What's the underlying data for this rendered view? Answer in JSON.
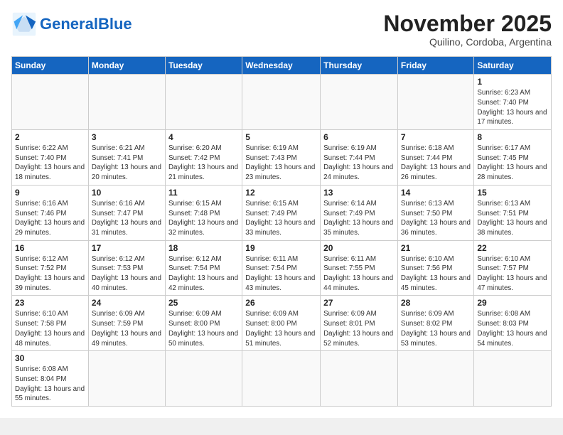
{
  "header": {
    "logo_general": "General",
    "logo_blue": "Blue",
    "month_title": "November 2025",
    "subtitle": "Quilino, Cordoba, Argentina"
  },
  "days_of_week": [
    "Sunday",
    "Monday",
    "Tuesday",
    "Wednesday",
    "Thursday",
    "Friday",
    "Saturday"
  ],
  "weeks": [
    [
      {
        "day": "",
        "info": ""
      },
      {
        "day": "",
        "info": ""
      },
      {
        "day": "",
        "info": ""
      },
      {
        "day": "",
        "info": ""
      },
      {
        "day": "",
        "info": ""
      },
      {
        "day": "",
        "info": ""
      },
      {
        "day": "1",
        "info": "Sunrise: 6:23 AM\nSunset: 7:40 PM\nDaylight: 13 hours\nand 17 minutes."
      }
    ],
    [
      {
        "day": "2",
        "info": "Sunrise: 6:22 AM\nSunset: 7:40 PM\nDaylight: 13 hours\nand 18 minutes."
      },
      {
        "day": "3",
        "info": "Sunrise: 6:21 AM\nSunset: 7:41 PM\nDaylight: 13 hours\nand 20 minutes."
      },
      {
        "day": "4",
        "info": "Sunrise: 6:20 AM\nSunset: 7:42 PM\nDaylight: 13 hours\nand 21 minutes."
      },
      {
        "day": "5",
        "info": "Sunrise: 6:19 AM\nSunset: 7:43 PM\nDaylight: 13 hours\nand 23 minutes."
      },
      {
        "day": "6",
        "info": "Sunrise: 6:19 AM\nSunset: 7:44 PM\nDaylight: 13 hours\nand 24 minutes."
      },
      {
        "day": "7",
        "info": "Sunrise: 6:18 AM\nSunset: 7:44 PM\nDaylight: 13 hours\nand 26 minutes."
      },
      {
        "day": "8",
        "info": "Sunrise: 6:17 AM\nSunset: 7:45 PM\nDaylight: 13 hours\nand 28 minutes."
      }
    ],
    [
      {
        "day": "9",
        "info": "Sunrise: 6:16 AM\nSunset: 7:46 PM\nDaylight: 13 hours\nand 29 minutes."
      },
      {
        "day": "10",
        "info": "Sunrise: 6:16 AM\nSunset: 7:47 PM\nDaylight: 13 hours\nand 31 minutes."
      },
      {
        "day": "11",
        "info": "Sunrise: 6:15 AM\nSunset: 7:48 PM\nDaylight: 13 hours\nand 32 minutes."
      },
      {
        "day": "12",
        "info": "Sunrise: 6:15 AM\nSunset: 7:49 PM\nDaylight: 13 hours\nand 33 minutes."
      },
      {
        "day": "13",
        "info": "Sunrise: 6:14 AM\nSunset: 7:49 PM\nDaylight: 13 hours\nand 35 minutes."
      },
      {
        "day": "14",
        "info": "Sunrise: 6:13 AM\nSunset: 7:50 PM\nDaylight: 13 hours\nand 36 minutes."
      },
      {
        "day": "15",
        "info": "Sunrise: 6:13 AM\nSunset: 7:51 PM\nDaylight: 13 hours\nand 38 minutes."
      }
    ],
    [
      {
        "day": "16",
        "info": "Sunrise: 6:12 AM\nSunset: 7:52 PM\nDaylight: 13 hours\nand 39 minutes."
      },
      {
        "day": "17",
        "info": "Sunrise: 6:12 AM\nSunset: 7:53 PM\nDaylight: 13 hours\nand 40 minutes."
      },
      {
        "day": "18",
        "info": "Sunrise: 6:12 AM\nSunset: 7:54 PM\nDaylight: 13 hours\nand 42 minutes."
      },
      {
        "day": "19",
        "info": "Sunrise: 6:11 AM\nSunset: 7:54 PM\nDaylight: 13 hours\nand 43 minutes."
      },
      {
        "day": "20",
        "info": "Sunrise: 6:11 AM\nSunset: 7:55 PM\nDaylight: 13 hours\nand 44 minutes."
      },
      {
        "day": "21",
        "info": "Sunrise: 6:10 AM\nSunset: 7:56 PM\nDaylight: 13 hours\nand 45 minutes."
      },
      {
        "day": "22",
        "info": "Sunrise: 6:10 AM\nSunset: 7:57 PM\nDaylight: 13 hours\nand 47 minutes."
      }
    ],
    [
      {
        "day": "23",
        "info": "Sunrise: 6:10 AM\nSunset: 7:58 PM\nDaylight: 13 hours\nand 48 minutes."
      },
      {
        "day": "24",
        "info": "Sunrise: 6:09 AM\nSunset: 7:59 PM\nDaylight: 13 hours\nand 49 minutes."
      },
      {
        "day": "25",
        "info": "Sunrise: 6:09 AM\nSunset: 8:00 PM\nDaylight: 13 hours\nand 50 minutes."
      },
      {
        "day": "26",
        "info": "Sunrise: 6:09 AM\nSunset: 8:00 PM\nDaylight: 13 hours\nand 51 minutes."
      },
      {
        "day": "27",
        "info": "Sunrise: 6:09 AM\nSunset: 8:01 PM\nDaylight: 13 hours\nand 52 minutes."
      },
      {
        "day": "28",
        "info": "Sunrise: 6:09 AM\nSunset: 8:02 PM\nDaylight: 13 hours\nand 53 minutes."
      },
      {
        "day": "29",
        "info": "Sunrise: 6:08 AM\nSunset: 8:03 PM\nDaylight: 13 hours\nand 54 minutes."
      }
    ],
    [
      {
        "day": "30",
        "info": "Sunrise: 6:08 AM\nSunset: 8:04 PM\nDaylight: 13 hours\nand 55 minutes."
      },
      {
        "day": "",
        "info": ""
      },
      {
        "day": "",
        "info": ""
      },
      {
        "day": "",
        "info": ""
      },
      {
        "day": "",
        "info": ""
      },
      {
        "day": "",
        "info": ""
      },
      {
        "day": "",
        "info": ""
      }
    ]
  ]
}
